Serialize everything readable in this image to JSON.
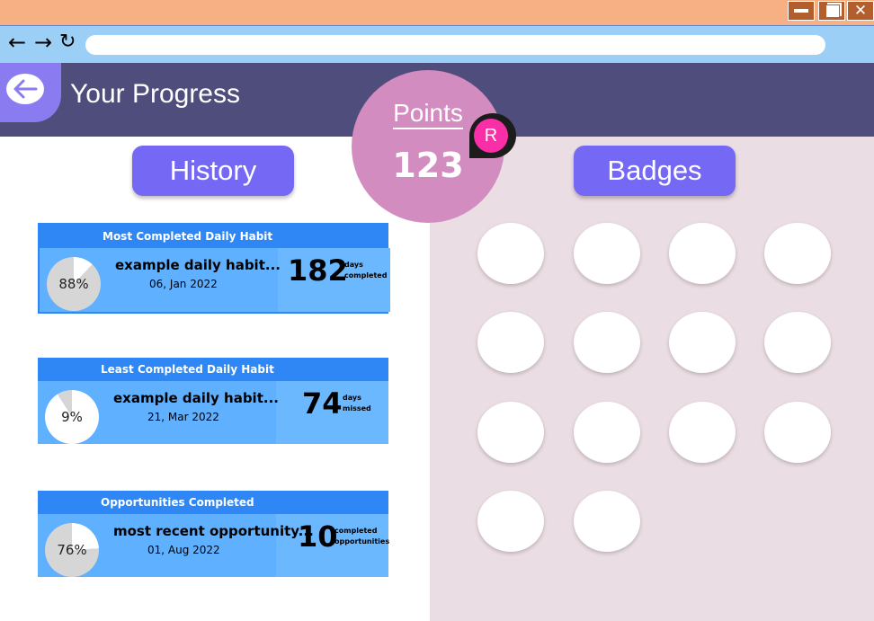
{
  "window": {
    "controls": {
      "close_glyph": "✕"
    }
  },
  "browser": {
    "back_glyph": "←",
    "forward_glyph": "→",
    "reload_glyph": "↻",
    "url": ""
  },
  "header": {
    "title": "Your Progress"
  },
  "points": {
    "label": "Points",
    "value": "123"
  },
  "avatar": {
    "initial": "R",
    "color": "#fa2fa7"
  },
  "sections": {
    "history_label": "History",
    "badges_label": "Badges"
  },
  "cards": [
    {
      "heading": "Most Completed Daily Habit",
      "percent_label": "88%",
      "percent": 88,
      "name": "example daily habit...",
      "date": "06, Jan 2022",
      "number": "182",
      "unit_line1": "days",
      "unit_line2": "completed"
    },
    {
      "heading": "Least Completed Daily Habit",
      "percent_label": "9%",
      "percent": 9,
      "name": "example daily habit...",
      "date": "21, Mar 2022",
      "number": "74",
      "unit_line1": "days",
      "unit_line2": "missed"
    },
    {
      "heading": "Opportunities Completed",
      "percent_label": "76%",
      "percent": 76,
      "name": "most recent opportunity...",
      "date": "01, Aug 2022",
      "number": "10",
      "unit_line1": "completed",
      "unit_line2": "opportunities"
    }
  ],
  "badges": {
    "slot_count": 14
  },
  "colors": {
    "title_bar": "#f7b083",
    "toolbar": "#9ccff5",
    "header": "#4f4d7c",
    "accent_button": "#7468f4",
    "points_bubble": "#d38cbf",
    "card_head": "#2f86f5",
    "card_body": "#5fb0ff",
    "badges_panel": "#eadde3"
  }
}
